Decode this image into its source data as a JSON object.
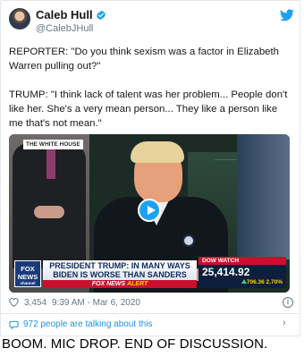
{
  "tweet": {
    "author_name": "Caleb Hull",
    "author_handle": "@CalebJHull",
    "paragraphs": [
      "REPORTER: \"Do you think sexism was a factor in Elizabeth Warren pulling out?\"",
      "TRUMP: \"I think lack of talent was her problem... People don't like her. She's a very mean person... They like a person like me that's not mean.\""
    ],
    "like_count": "3,454",
    "timestamp": "9:39 AM - Mar 6, 2020",
    "talking_text": "972 people are talking about this"
  },
  "video": {
    "white_house_tag": "THE WHITE HOUSE",
    "network_logo": [
      "FOX",
      "NEWS"
    ],
    "network_sub": "channel",
    "headline": "PRESIDENT TRUMP: IN MANY WAYS BIDEN IS WORSE THAN SANDERS",
    "alert_brand": "FOX NEWS",
    "alert_word": "ALERT",
    "dow_label": "DOW WATCH",
    "dow_value": "25,414.92",
    "dow_change": "706.36 2.70%"
  },
  "caption": "BOOM. MIC DROP. END OF DISCUSSION.",
  "colors": {
    "twitter_blue": "#1da1f2",
    "link_blue": "#1b95e0",
    "muted_gray": "#657786",
    "fox_red": "#c8102e",
    "fox_navy": "#0e1f3d"
  },
  "icons": [
    "verified-badge-icon",
    "twitter-bird-icon",
    "play-icon",
    "heart-icon",
    "info-icon",
    "chat-bubble-icon",
    "chevron-right-icon"
  ]
}
